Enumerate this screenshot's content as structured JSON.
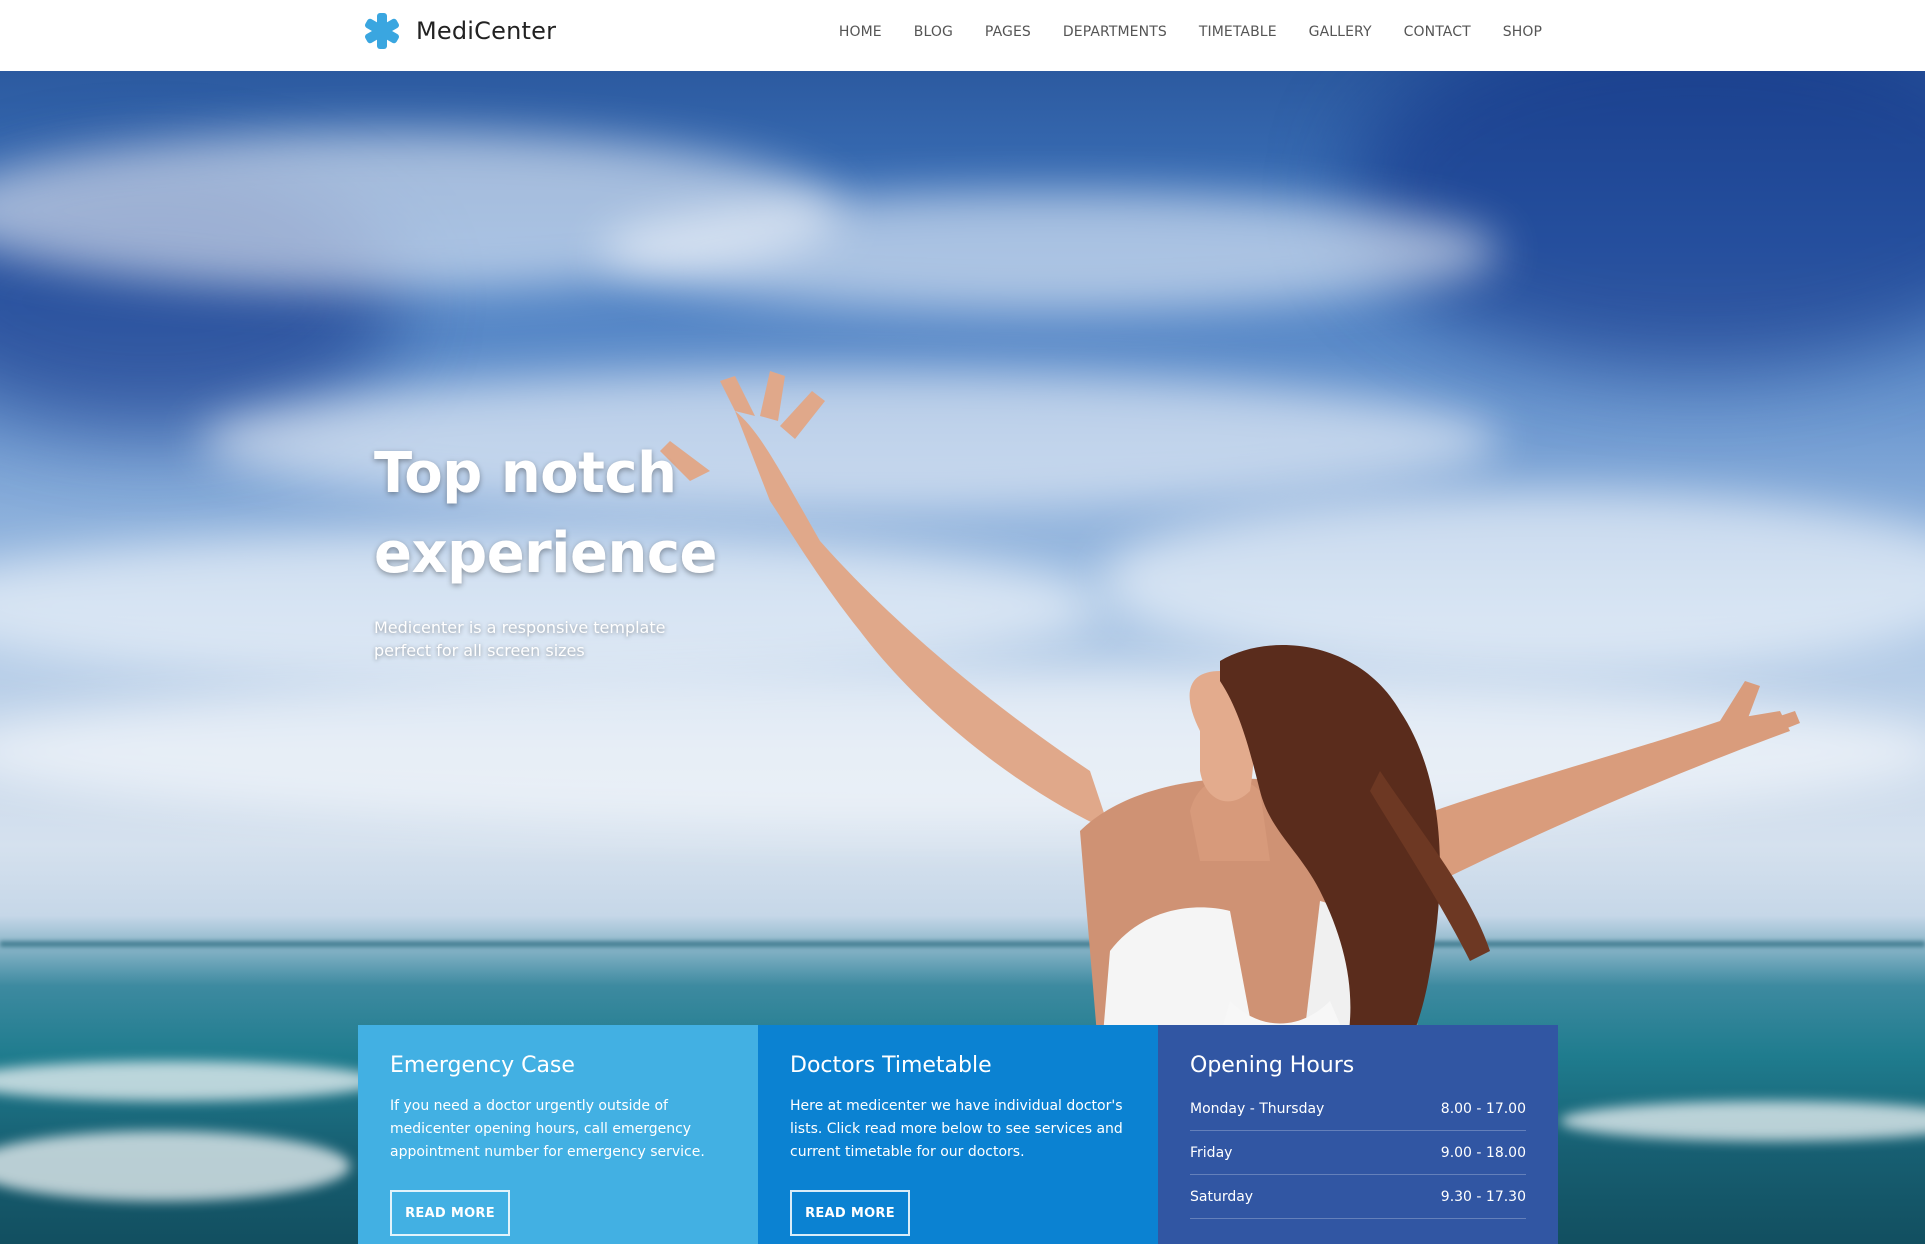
{
  "site": {
    "name": "MediCenter",
    "logo_icon": "asterisk-medical-icon",
    "accent_color": "#42b0e3"
  },
  "nav": {
    "items": [
      {
        "label": "HOME"
      },
      {
        "label": "BLOG"
      },
      {
        "label": "PAGES"
      },
      {
        "label": "DEPARTMENTS"
      },
      {
        "label": "TIMETABLE"
      },
      {
        "label": "GALLERY"
      },
      {
        "label": "CONTACT"
      },
      {
        "label": "SHOP"
      }
    ]
  },
  "hero": {
    "title": "Top notch experience",
    "subtitle": "Medicenter is a responsive template perfect for all screen sizes"
  },
  "boxes": {
    "emergency": {
      "title": "Emergency Case",
      "text": "If you need a doctor urgently outside of medicenter opening hours, call emergency appointment number for emergency service.",
      "button": "READ MORE",
      "color": "#42b0e3"
    },
    "timetable": {
      "title": "Doctors Timetable",
      "text": "Here at medicenter we have individual doctor's lists. Click read more below to see services and current timetable for our doctors.",
      "button": "READ MORE",
      "color": "#0b82d2"
    },
    "hours": {
      "title": "Opening Hours",
      "color": "#3156a3",
      "rows": [
        {
          "day": "Monday - Thursday",
          "time": "8.00 - 17.00"
        },
        {
          "day": "Friday",
          "time": "9.00 - 18.00"
        },
        {
          "day": "Saturday",
          "time": "9.30 - 17.30"
        }
      ]
    }
  }
}
